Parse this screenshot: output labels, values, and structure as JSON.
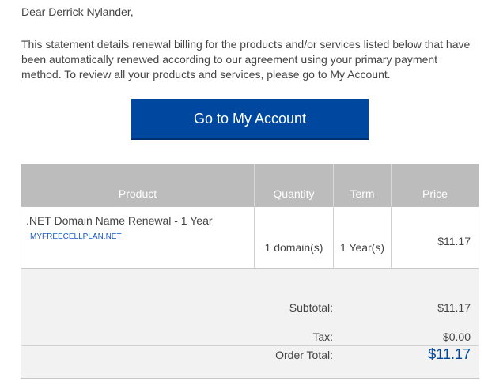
{
  "email": {
    "greeting": "Dear Derrick Nylander,",
    "intro": "This statement details renewal billing for the products and/or services listed below that have been automatically renewed according to our agreement using your primary payment method. To review all your products and services, please go to My Account.",
    "cta_label": "Go to My Account"
  },
  "table": {
    "headers": {
      "product": "Product",
      "quantity": "Quantity",
      "term": "Term",
      "price": "Price"
    },
    "items": [
      {
        "product": ".NET Domain Name Renewal - 1 Year",
        "domain": "MYFREECELLPLAN.NET",
        "quantity": "1 domain(s)",
        "term": "1 Year(s)",
        "price": "$11.17"
      }
    ],
    "summary": {
      "subtotal_label": "Subtotal:",
      "subtotal_value": "$11.17",
      "tax_label": "Tax:",
      "tax_value": "$0.00",
      "total_label": "Order Total:",
      "total_value": "$11.17"
    }
  },
  "colors": {
    "button": "#0047a0",
    "header": "#bcbcbc",
    "link": "#1a56c8",
    "total": "#0047a0"
  }
}
